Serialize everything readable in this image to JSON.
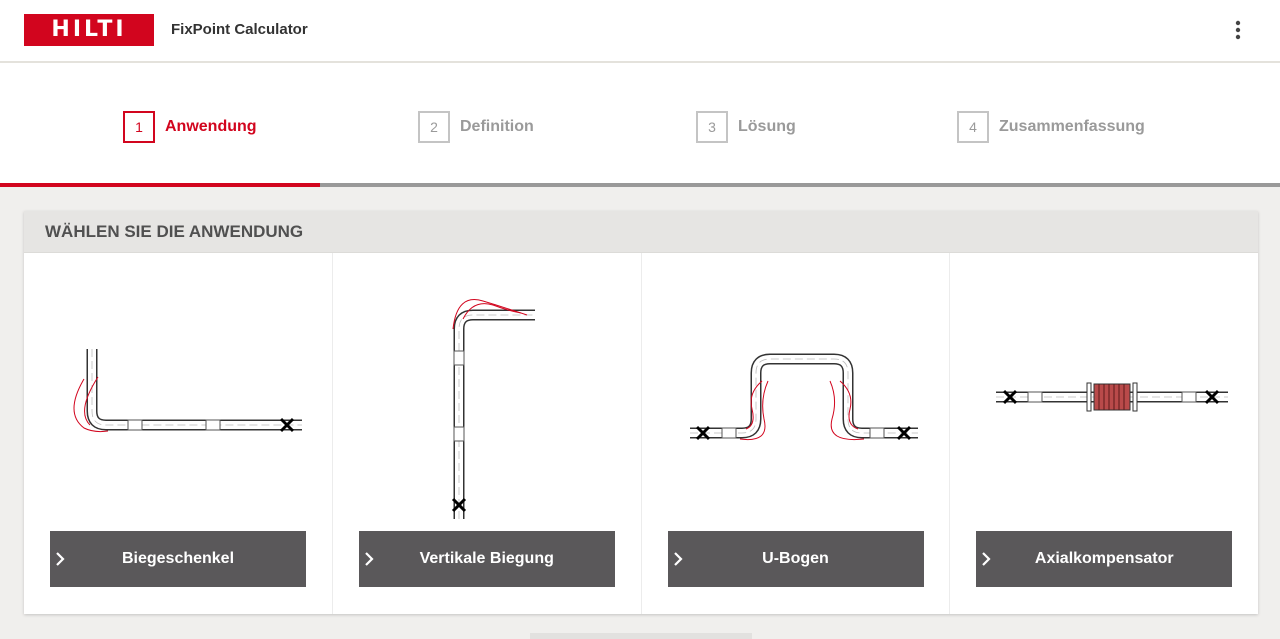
{
  "header": {
    "logo_text": "HILTI",
    "app_title": "FixPoint Calculator",
    "menu_icon": "more-vertical-icon"
  },
  "steps": [
    {
      "number": "1",
      "label": "Anwendung",
      "active": true
    },
    {
      "number": "2",
      "label": "Definition",
      "active": false
    },
    {
      "number": "3",
      "label": "Lösung",
      "active": false
    },
    {
      "number": "4",
      "label": "Zusammenfassung",
      "active": false
    }
  ],
  "progress": {
    "current_step": 1,
    "total_steps": 4
  },
  "panel": {
    "title": "WÄHLEN SIE DIE ANWENDUNG",
    "options": [
      {
        "label": "Biegeschenkel",
        "icon": "l-bend-pipe-diagram"
      },
      {
        "label": "Vertikale Biegung",
        "icon": "vertical-bend-pipe-diagram"
      },
      {
        "label": "U-Bogen",
        "icon": "u-bend-pipe-diagram"
      },
      {
        "label": "Axialkompensator",
        "icon": "axial-compensator-pipe-diagram"
      }
    ]
  },
  "colors": {
    "brand_red": "#d2051e",
    "button_dark": "#5a585a",
    "inactive_gray": "#9a9a9a",
    "background": "#f0efed"
  }
}
